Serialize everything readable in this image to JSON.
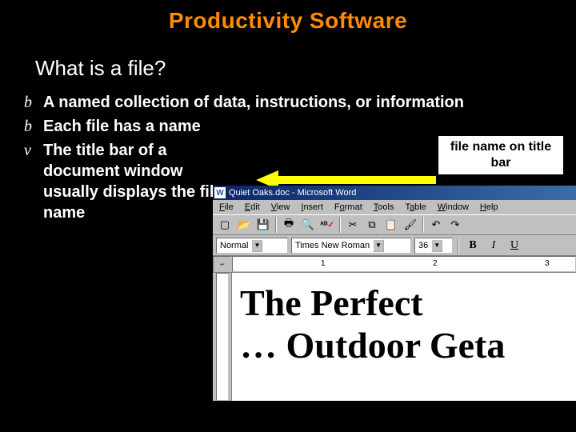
{
  "slide": {
    "title": "Productivity Software",
    "heading": "What is a file?",
    "bullets": [
      {
        "marker": "b",
        "text": "A named collection of data, instructions, or information"
      },
      {
        "marker": "b",
        "text": "Each file has a name"
      },
      {
        "marker": "v",
        "text": "The title bar of a document window usually displays the file name"
      }
    ],
    "annotation": "file name on title bar"
  },
  "word": {
    "titlebar": "Quiet Oaks.doc - Microsoft Word",
    "menus": [
      "File",
      "Edit",
      "View",
      "Insert",
      "Format",
      "Tools",
      "Table",
      "Window",
      "Help"
    ],
    "style_combo": "Normal",
    "font_combo": "Times New Roman",
    "size_combo": "36",
    "ruler_marks": [
      "1",
      "2",
      "3"
    ],
    "doc_line1": "The Perfect",
    "doc_line2": "… Outdoor Geta"
  }
}
